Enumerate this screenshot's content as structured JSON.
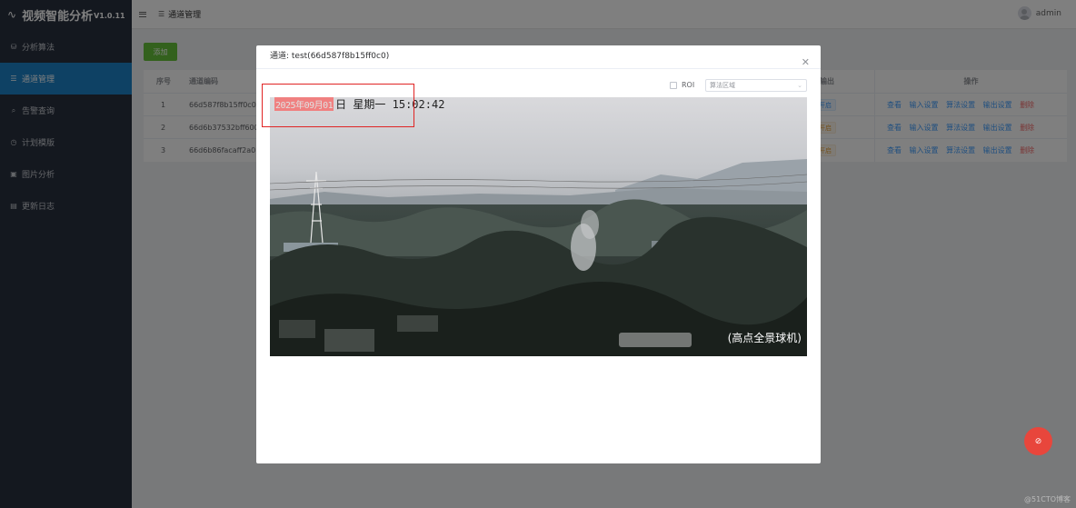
{
  "app": {
    "title": "视频智能分析",
    "version": "V1.0.11"
  },
  "sidebar": {
    "items": [
      {
        "label": "分析算法",
        "icon": "algorithm-icon"
      },
      {
        "label": "通道管理",
        "icon": "list-icon",
        "active": true
      },
      {
        "label": "告警查询",
        "icon": "search-icon"
      },
      {
        "label": "计划模版",
        "icon": "clock-icon"
      },
      {
        "label": "图片分析",
        "icon": "image-icon"
      },
      {
        "label": "更新日志",
        "icon": "document-icon"
      }
    ]
  },
  "header": {
    "breadcrumb": "通道管理",
    "user": "admin"
  },
  "toolbar": {
    "add_label": "添加"
  },
  "table": {
    "headers": {
      "index": "序号",
      "code": "通道编码",
      "output": "输出",
      "actions": "操作"
    },
    "rows": [
      {
        "index": "1",
        "code": "66d587f8b15ff0c0",
        "tag": "开启"
      },
      {
        "index": "2",
        "code": "66d6b37532bff600",
        "tag": "开启"
      },
      {
        "index": "3",
        "code": "66d6b86facaff2a0",
        "tag": "开启"
      }
    ],
    "actions": {
      "view": "查看",
      "input": "输入设置",
      "algorithm": "算法设置",
      "output": "输出设置",
      "delete": "删除"
    }
  },
  "dialog": {
    "title": "通道: test(66d587f8b15ff0c0)",
    "roi_label": "ROI",
    "region_placeholder": "算法区域",
    "video": {
      "osd_date": "2025年09月01",
      "osd_rest": "日  星期一  15:02:42",
      "camera_label": "(高点全景球机)"
    }
  },
  "watermark": "@51CTO博客",
  "colors": {
    "sidebar_bg": "#28303f",
    "active_menu": "#1d83c8",
    "add_button": "#67c23a",
    "link": "#409eff",
    "danger": "#f56c6c",
    "highlight_box": "#e02424"
  }
}
